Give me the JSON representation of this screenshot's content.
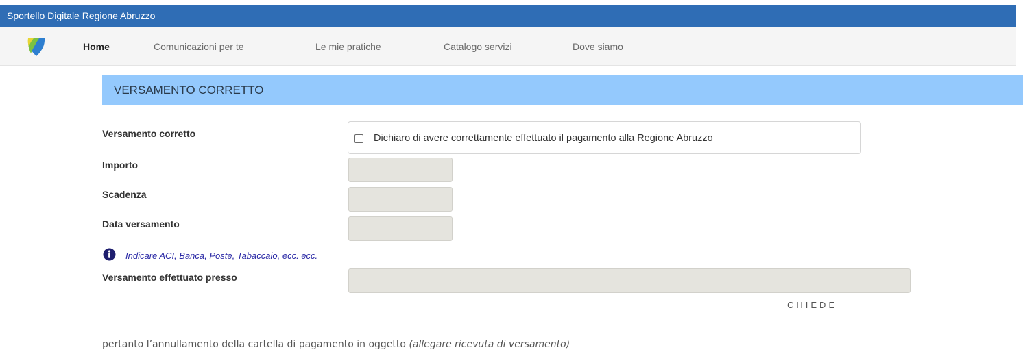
{
  "app": {
    "title": "Sportello Digitale Regione Abruzzo"
  },
  "nav": {
    "items": [
      {
        "label": "Home"
      },
      {
        "label": "Comunicazioni per te"
      },
      {
        "label": "Le mie pratiche"
      },
      {
        "label": "Catalogo servizi"
      },
      {
        "label": "Dove siamo"
      }
    ]
  },
  "section": {
    "title": "VERSAMENTO CORRETTO"
  },
  "form": {
    "versamento_corretto": {
      "label": "Versamento corretto",
      "checkbox_text": "Dichiaro di avere correttamente effettuato il pagamento alla Regione Abruzzo",
      "checked": false
    },
    "importo": {
      "label": "Importo",
      "value": ""
    },
    "scadenza": {
      "label": "Scadenza",
      "value": ""
    },
    "data_versamento": {
      "label": "Data versamento",
      "value": ""
    },
    "hint": "Indicare ACI, Banca, Poste, Tabaccaio, ecc. ecc.",
    "presso": {
      "label": "Versamento effettuato presso",
      "value": ""
    }
  },
  "chiede": "CHIEDE",
  "footer": {
    "text": "pertanto l’annullamento della cartella di pagamento in oggetto",
    "note": "(allegare ricevuta di versamento)"
  },
  "colors": {
    "topbar": "#2f6db5",
    "section_header": "#94c9fd",
    "input_bg": "#e5e4de",
    "hint_text": "#2b2aa6"
  },
  "icons": [
    "regione-abruzzo-logo",
    "info-icon"
  ]
}
